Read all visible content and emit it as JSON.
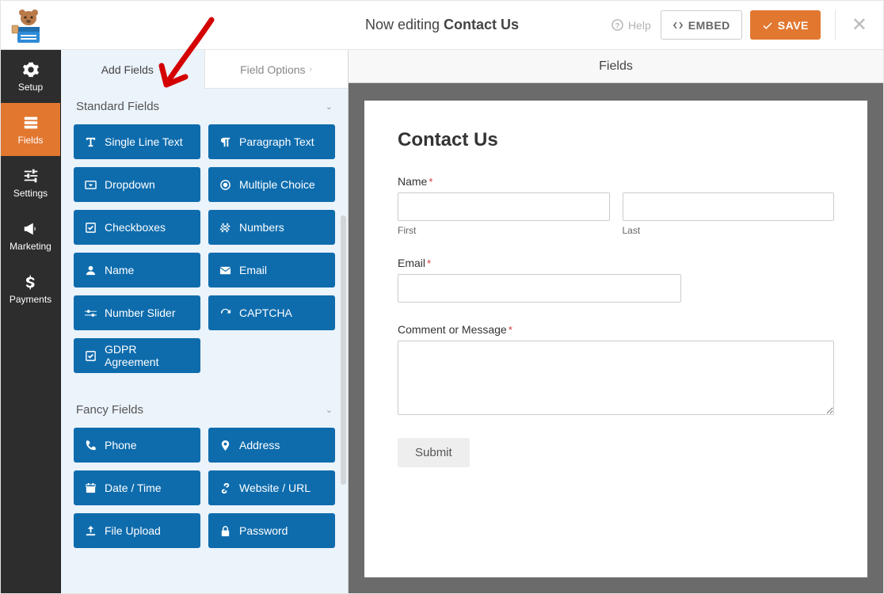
{
  "header": {
    "editing_prefix": "Now editing ",
    "editing_title": "Contact Us",
    "help": "Help",
    "embed": "EMBED",
    "save": "SAVE",
    "close": "✕"
  },
  "nav": {
    "setup": "Setup",
    "fields": "Fields",
    "settings": "Settings",
    "marketing": "Marketing",
    "payments": "Payments"
  },
  "subtabs": {
    "add_fields": "Add Fields",
    "field_options": "Field Options"
  },
  "standard_fields": {
    "title": "Standard Fields",
    "items": {
      "single_line": "Single Line Text",
      "paragraph": "Paragraph Text",
      "dropdown": "Dropdown",
      "multiple_choice": "Multiple Choice",
      "checkboxes": "Checkboxes",
      "numbers": "Numbers",
      "name": "Name",
      "email": "Email",
      "number_slider": "Number Slider",
      "captcha": "CAPTCHA",
      "gdpr": "GDPR Agreement"
    }
  },
  "fancy_fields": {
    "title": "Fancy Fields",
    "items": {
      "phone": "Phone",
      "address": "Address",
      "datetime": "Date / Time",
      "website": "Website / URL",
      "file_upload": "File Upload",
      "password": "Password"
    }
  },
  "preview": {
    "panel_title": "Fields",
    "form_title": "Contact Us",
    "name_label": "Name",
    "first_label": "First",
    "last_label": "Last",
    "email_label": "Email",
    "comment_label": "Comment or Message",
    "submit": "Submit"
  }
}
